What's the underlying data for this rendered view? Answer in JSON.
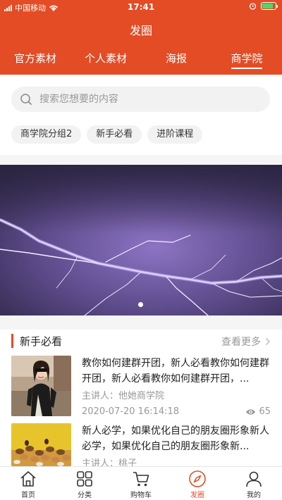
{
  "status_bar": {
    "carrier": "中国移动",
    "time": "17:41"
  },
  "header": {
    "title": "发圈",
    "tabs": [
      {
        "label": "官方素材"
      },
      {
        "label": "个人素材"
      },
      {
        "label": "海报"
      },
      {
        "label": "商学院"
      }
    ],
    "active_tab": "商学院"
  },
  "search": {
    "placeholder": "搜索您想要的内容"
  },
  "chips": [
    {
      "label": "商学院分组2"
    },
    {
      "label": "新手必看"
    },
    {
      "label": "进阶课程"
    }
  ],
  "banner": {
    "current_index": 0,
    "description": "lightning"
  },
  "section": {
    "title": "新手必看",
    "more_label": "查看更多"
  },
  "courses": [
    {
      "title": "教你如何建群开团，新人必看教你如何建群开团，新人必看教你如何建群开团，...",
      "speaker": "主讲人：他她商学院",
      "date": "2020-07-20 16:14:18",
      "views": "65"
    },
    {
      "title": "新人必学，如果优化自己的朋友圈形象新人必学，如果优化自己的朋友圈形象新...",
      "speaker": "主讲人：桃子"
    }
  ],
  "bottom_nav": [
    {
      "label": "首页",
      "icon": "home-icon"
    },
    {
      "label": "分类",
      "icon": "grid-icon"
    },
    {
      "label": "购物车",
      "icon": "cart-icon"
    },
    {
      "label": "发圈",
      "icon": "compass-icon"
    },
    {
      "label": "我的",
      "icon": "user-icon"
    }
  ],
  "colors": {
    "accent": "#e34c25",
    "battery": "#4cd964"
  }
}
